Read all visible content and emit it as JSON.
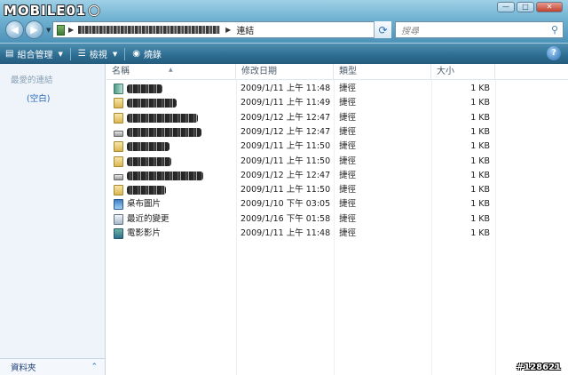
{
  "logo": {
    "text": "MOBILE01"
  },
  "window_controls": {
    "minimize": "—",
    "maximize": "□",
    "close": "✕"
  },
  "address": {
    "current": "連結",
    "breadcrumb_hidden": true
  },
  "search": {
    "placeholder": "搜尋"
  },
  "toolbar": {
    "organize": "組合管理",
    "views": "檢視",
    "burn": "燒錄"
  },
  "sidebar": {
    "favorites_title": "最愛的連結",
    "favorites_empty": "(空白)",
    "folders_label": "資料夾"
  },
  "columns": {
    "name": "名稱",
    "date": "修改日期",
    "type": "類型",
    "size": "大小"
  },
  "files": [
    {
      "name": "",
      "hidden": true,
      "obscure_width": 40,
      "icon": "green",
      "date": "2009/1/11 上午 11:48",
      "type": "捷徑",
      "size": "1 KB"
    },
    {
      "name": "",
      "hidden": true,
      "obscure_width": 56,
      "icon": "folder",
      "date": "2009/1/11 上午 11:49",
      "type": "捷徑",
      "size": "1 KB"
    },
    {
      "name": "",
      "hidden": true,
      "obscure_width": 80,
      "icon": "folder",
      "date": "2009/1/12 上午 12:47",
      "type": "捷徑",
      "size": "1 KB"
    },
    {
      "name": "",
      "hidden": true,
      "obscure_width": 84,
      "icon": "drive",
      "date": "2009/1/12 上午 12:47",
      "type": "捷徑",
      "size": "1 KB"
    },
    {
      "name": "",
      "hidden": true,
      "obscure_width": 48,
      "icon": "folder",
      "date": "2009/1/11 上午 11:50",
      "type": "捷徑",
      "size": "1 KB"
    },
    {
      "name": "",
      "hidden": true,
      "obscure_width": 50,
      "icon": "folder",
      "date": "2009/1/11 上午 11:50",
      "type": "捷徑",
      "size": "1 KB"
    },
    {
      "name": "",
      "hidden": true,
      "obscure_width": 86,
      "icon": "drive",
      "date": "2009/1/12 上午 12:47",
      "type": "捷徑",
      "size": "1 KB"
    },
    {
      "name": "",
      "hidden": true,
      "obscure_width": 44,
      "icon": "folder",
      "date": "2009/1/11 上午 11:50",
      "type": "捷徑",
      "size": "1 KB"
    },
    {
      "name": "桌布圖片",
      "hidden": false,
      "icon": "desk",
      "date": "2009/1/10 下午 03:05",
      "type": "捷徑",
      "size": "1 KB"
    },
    {
      "name": "最近的變更",
      "hidden": false,
      "icon": "recent",
      "date": "2009/1/16 下午 01:58",
      "type": "捷徑",
      "size": "1 KB"
    },
    {
      "name": "電影影片",
      "hidden": false,
      "icon": "video",
      "date": "2009/1/11 上午 11:48",
      "type": "捷徑",
      "size": "1 KB"
    }
  ],
  "watermark": "#128621"
}
